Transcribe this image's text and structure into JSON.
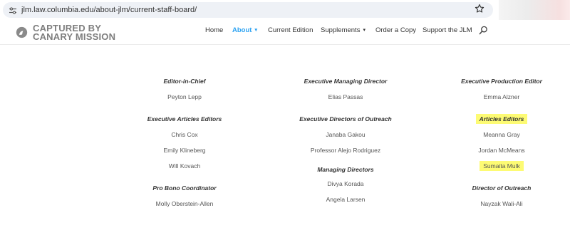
{
  "browser": {
    "url": "jlm.law.columbia.edu/about-jlm/current-staff-board/"
  },
  "header": {
    "logo_line1": "CAPTURED BY",
    "logo_line2": "CANARY MISSION",
    "nav": [
      {
        "label": "Home",
        "active": false
      },
      {
        "label": "About",
        "active": true,
        "has_dropdown": true
      },
      {
        "label": "Current Edition",
        "active": false
      },
      {
        "label": "Supplements",
        "active": false,
        "has_dropdown": true
      },
      {
        "label": "Order a Copy",
        "active": false
      },
      {
        "label": "Support the JLM",
        "active": false
      }
    ]
  },
  "columns": [
    {
      "groups": [
        {
          "role": "Editor-in-Chief",
          "names": [
            "Peyton Lepp"
          ]
        },
        {
          "role": "Executive Articles Editors",
          "names": [
            "Chris Cox",
            "Emily Klineberg",
            "Will Kovach"
          ]
        },
        {
          "role": "Pro Bono Coordinator",
          "names": [
            "Molly Oberstein-Allen"
          ]
        }
      ]
    },
    {
      "groups": [
        {
          "role": "Executive Managing Director",
          "names": [
            "Elias Passas"
          ]
        },
        {
          "role": "Executive Directors of Outreach",
          "names": [
            "Janaba Gakou",
            "Professor Alejo Rodriguez"
          ]
        },
        {
          "role": "Managing Directors",
          "names": [
            "Divya Korada",
            "Angela Larsen"
          ]
        }
      ]
    },
    {
      "groups": [
        {
          "role": "Executive Production Editor",
          "names": [
            "Emma Alzner"
          ]
        },
        {
          "role": "Articles Editors",
          "names": [
            "Meanna Gray",
            "Jordan McMeans",
            "Sumaita Mulk"
          ]
        },
        {
          "role": "Director of Outreach",
          "names": [
            "Nayzak Wali-Ali"
          ]
        }
      ]
    }
  ],
  "highlight_color": "#fdfb74",
  "accent_color": "#2ea3f2",
  "icons": [
    "site-settings-icon",
    "star-icon",
    "logo-icon",
    "search-icon",
    "chevron-down-icon"
  ]
}
